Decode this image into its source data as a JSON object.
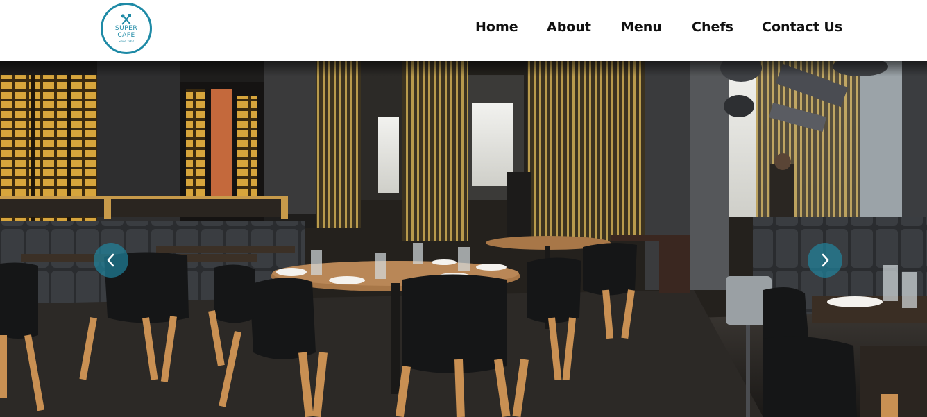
{
  "brand": {
    "line1": "SUPER",
    "line2": "CAFE",
    "since": "Since 1962",
    "accent_color": "#1e8aa6",
    "icon": "fork-knife-icon"
  },
  "nav": {
    "items": [
      {
        "label": "Home"
      },
      {
        "label": "About"
      },
      {
        "label": "Menu"
      },
      {
        "label": "Chefs"
      },
      {
        "label": "Contact Us"
      }
    ]
  },
  "hero": {
    "image_alt": "restaurant-interior-photo",
    "prev_icon": "chevron-left-icon",
    "next_icon": "chevron-right-icon"
  }
}
